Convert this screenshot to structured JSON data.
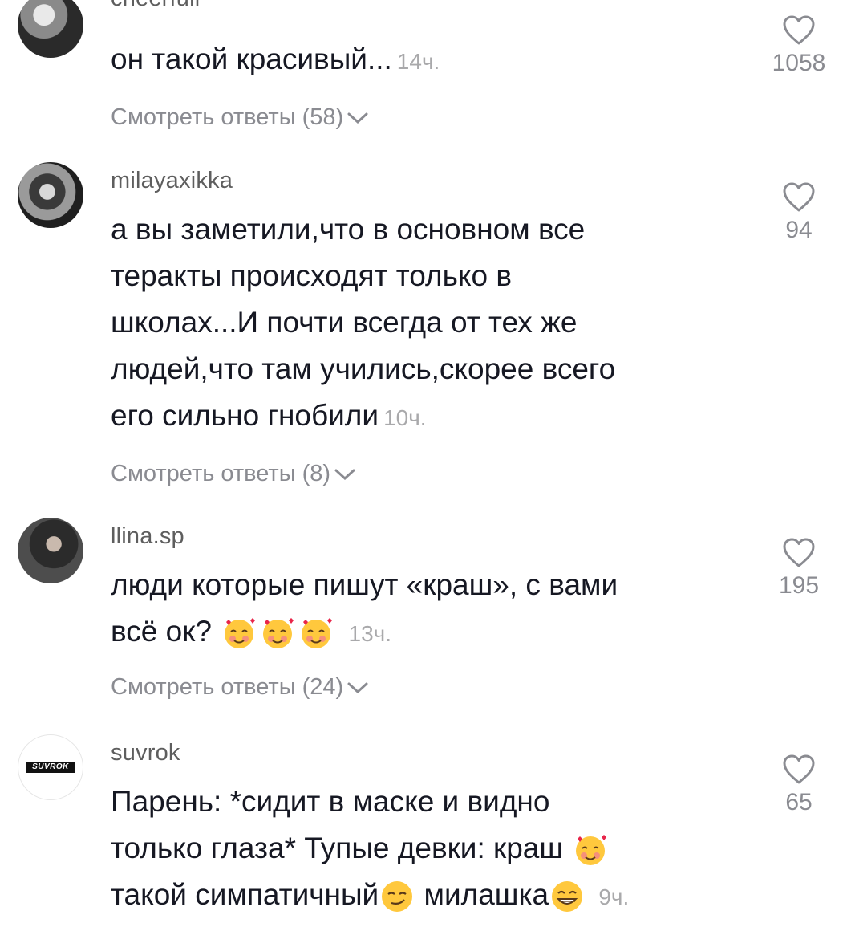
{
  "comments": [
    {
      "username": "cheerfull",
      "text": "он такой красивый...",
      "time": "14ч.",
      "likes": "1058",
      "replies": "Смотреть ответы (58)"
    },
    {
      "username": "milayaxikka",
      "lines": [
        "а вы заметили,что в основном все",
        "теракты происходят только в",
        "школах...И почти всегда от тех же",
        "людей,что там учились,скорее всего",
        "его сильно гнобили"
      ],
      "time": "10ч.",
      "likes": "94",
      "replies": "Смотреть ответы (8)"
    },
    {
      "username": "llina.sp",
      "lines": [
        "люди которые пишут «краш», с вами",
        "всё ок?"
      ],
      "time": "13ч.",
      "likes": "195",
      "replies": "Смотреть ответы (24)"
    },
    {
      "username": "suvrok",
      "avatar_text": "SUVROK",
      "lines": [
        "Парень: *сидит в маске и видно",
        "только глаза* Тупые девки: краш",
        "такой симпатичный",
        "милашка"
      ],
      "time": "9ч.",
      "likes": "65"
    }
  ],
  "colors": {
    "text": "#161823",
    "meta": "#8a8b91",
    "heart_stroke": "#8a8b91"
  },
  "icons": {
    "like": "heart-outline-icon",
    "expand": "chevron-down-icon",
    "emoji_love": "smiling-face-with-hearts-emoji",
    "emoji_smirk": "smirking-face-emoji",
    "emoji_grin": "beaming-face-emoji"
  }
}
